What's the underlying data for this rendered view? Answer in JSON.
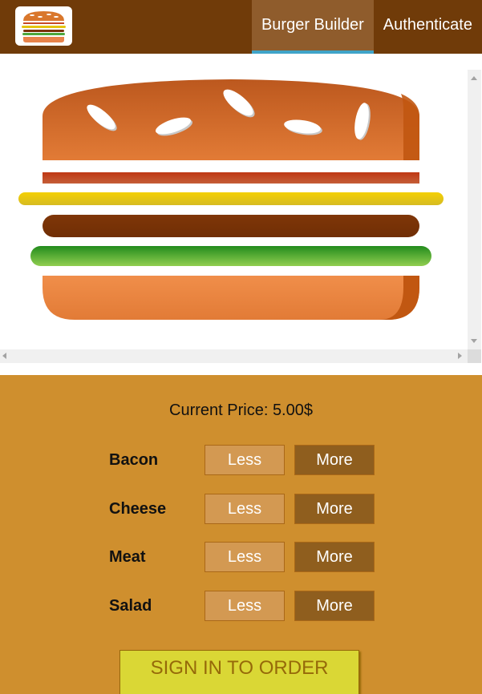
{
  "toolbar": {
    "logo_alt": "burger-logo",
    "nav": [
      {
        "label": "Burger Builder",
        "active": true
      },
      {
        "label": "Authenticate",
        "active": false
      }
    ]
  },
  "burger": {
    "layers": [
      "bread-top",
      "bacon",
      "cheese",
      "meat",
      "salad",
      "bread-bottom"
    ]
  },
  "controls": {
    "price_label": "Current Price:",
    "price_value": "5.00$",
    "items": [
      {
        "label": "Bacon",
        "less": "Less",
        "more": "More"
      },
      {
        "label": "Cheese",
        "less": "Less",
        "more": "More"
      },
      {
        "label": "Meat",
        "less": "Less",
        "more": "More"
      },
      {
        "label": "Salad",
        "less": "Less",
        "more": "More"
      }
    ],
    "order_label": "SIGN IN TO ORDER"
  },
  "colors": {
    "toolbar": "#703b09",
    "controls_bg": "#cf8f2e",
    "active_underline": "#40a4c8",
    "order_button": "#dad735"
  }
}
